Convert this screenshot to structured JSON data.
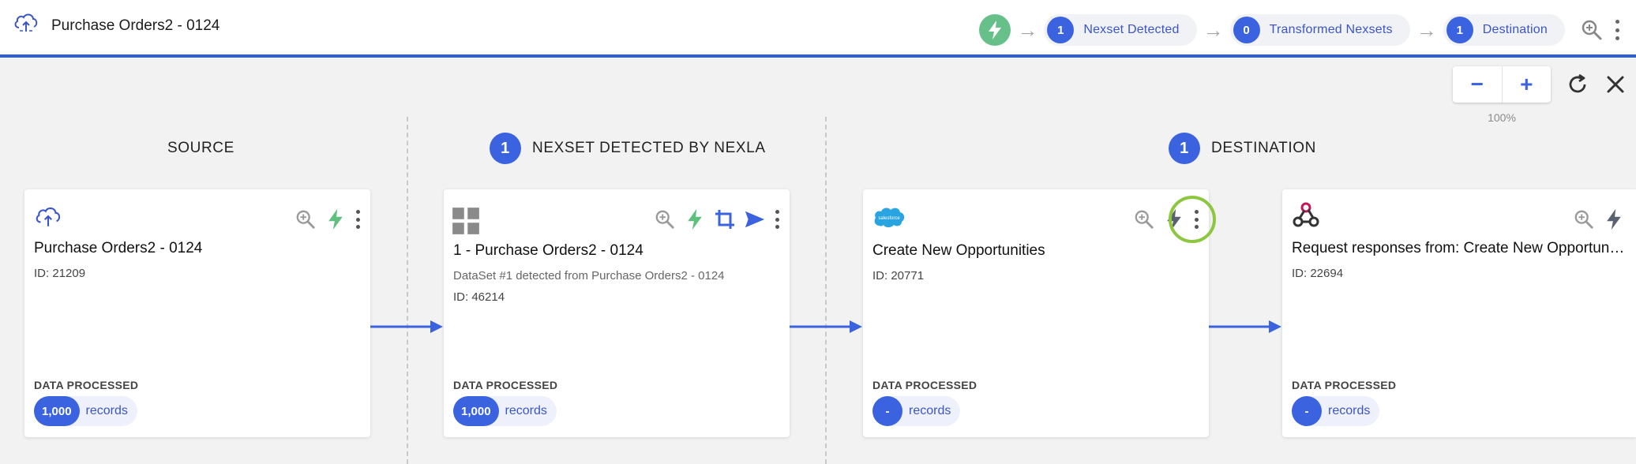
{
  "header": {
    "title": "Purchase Orders2 - 0124",
    "steps": [
      {
        "count": "1",
        "label": "Nexset Detected"
      },
      {
        "count": "0",
        "label": "Transformed Nexsets"
      },
      {
        "count": "1",
        "label": "Destination"
      }
    ]
  },
  "zoom": {
    "minus": "−",
    "plus": "+",
    "level": "100%"
  },
  "columns": {
    "source": {
      "label": "SOURCE"
    },
    "nexset": {
      "count": "1",
      "label": "NEXSET DETECTED BY NEXLA"
    },
    "destination": {
      "count": "1",
      "label": "DESTINATION"
    }
  },
  "cards": [
    {
      "title": "Purchase Orders2 - 0124",
      "id": "ID: 21209",
      "data_processed_label": "DATA PROCESSED",
      "records_count": "1,000",
      "records_label": "records"
    },
    {
      "title": "1 - Purchase Orders2 - 0124",
      "subtitle": "DataSet #1 detected from Purchase Orders2 - 0124",
      "id": "ID: 46214",
      "data_processed_label": "DATA PROCESSED",
      "records_count": "1,000",
      "records_label": "records"
    },
    {
      "title": "Create New Opportunities",
      "id": "ID: 20771",
      "data_processed_label": "DATA PROCESSED",
      "records_count": "-",
      "records_label": "records",
      "logo_text": "salesforce"
    },
    {
      "title": "Request responses from: Create New Opportunities",
      "id": "ID: 22694",
      "data_processed_label": "DATA PROCESSED",
      "records_count": "-",
      "records_label": "records"
    }
  ],
  "colors": {
    "accent": "#3b63e0",
    "status_green": "#67c08a",
    "highlight_ring": "#8dc63f",
    "header_border": "#2d5fd8"
  },
  "icons": [
    "cloud-upload-icon",
    "lightning-bolt-icon",
    "search-icon",
    "kebab-menu-icon",
    "grid-icon",
    "crop-transform-icon",
    "send-icon",
    "salesforce-logo-icon",
    "webhook-icon",
    "refresh-icon",
    "close-icon",
    "arrow-right-icon"
  ]
}
